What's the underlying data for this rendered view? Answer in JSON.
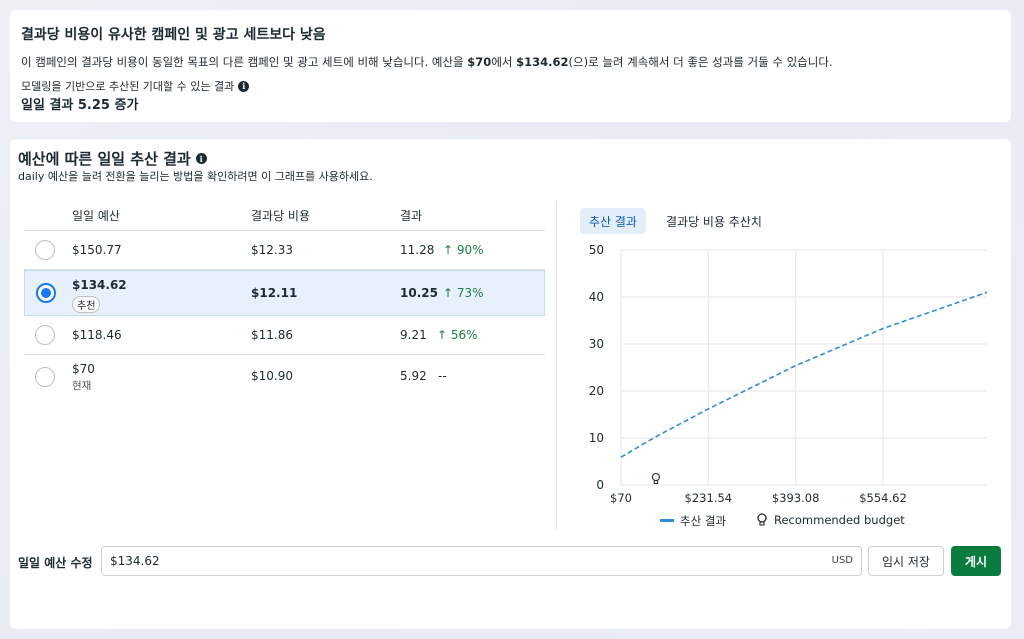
{
  "banner": {
    "title": "결과당 비용이 유사한 캠페인 및 광고 세트보다 낮음",
    "desc_pre": "이 캠페인의 결과당 비용이 동일한 목표의 다른 캠페인 및 광고 세트에 비해 낮습니다. 예산을 ",
    "desc_budget_from": "$70",
    "desc_mid": "에서 ",
    "desc_budget_to": "$134.62",
    "desc_post": "(으)로 늘려 계속해서 더 좋은 성과를 거둘 수 있습니다.",
    "model_note": "모델링을 기반으로 추산된 기대할 수 있는 결과",
    "daily_increase": "일일 결과 5.25 증가"
  },
  "section": {
    "title": "예산에 따른 일일 추산 결과",
    "subtitle": "daily 예산을 늘려 전환을 늘리는 방법을 확인하려면 이 그래프를 사용하세요."
  },
  "table": {
    "headers": [
      "일일 예산",
      "결과당 비용",
      "결과"
    ],
    "rows": [
      {
        "budget": "$150.77",
        "tag": "",
        "cost": "$12.33",
        "results": "11.28",
        "change": "↑ 90%",
        "selected": false
      },
      {
        "budget": "$134.62",
        "tag": "추천",
        "cost": "$12.11",
        "results": "10.25",
        "change": "↑ 73%",
        "selected": true
      },
      {
        "budget": "$118.46",
        "tag": "",
        "cost": "$11.86",
        "results": "9.21",
        "change": "↑ 56%",
        "selected": false
      },
      {
        "budget": "$70",
        "tag": "현재",
        "cost": "$10.90",
        "results": "5.92",
        "change": "--",
        "selected": false
      }
    ]
  },
  "tabs": [
    "추산 결과",
    "결과당 비용 추산치"
  ],
  "chart_data": {
    "type": "line",
    "x_ticks": [
      "$70",
      "$231.54",
      "$393.08",
      "$554.62"
    ],
    "x_range": [
      70,
      747
    ],
    "y_ticks": [
      0,
      10,
      20,
      30,
      40,
      50
    ],
    "ylim": [
      0,
      50
    ],
    "series": [
      {
        "name": "추산 결과",
        "style": "dashed",
        "color": "#2d8fd5",
        "points": [
          [
            70,
            5.92
          ],
          [
            118.46,
            9.21
          ],
          [
            134.62,
            10.25
          ],
          [
            150.77,
            11.28
          ],
          [
            231.54,
            16.2
          ],
          [
            393.08,
            25.4
          ],
          [
            554.62,
            33.3
          ],
          [
            747,
            41.0
          ]
        ]
      }
    ],
    "marker": {
      "name": "Recommended budget",
      "x": 134.62
    },
    "grid": true,
    "legend": "bottom"
  },
  "legend": {
    "series_label": "추산 결과",
    "marker_label": "Recommended budget"
  },
  "edit": {
    "label": "일일 예산 수정",
    "value": "$134.62",
    "currency": "USD",
    "draft_button": "임시 저장",
    "publish_button": "게시"
  },
  "colors": {
    "accent": "#1877f2",
    "publish": "#0a7b3e",
    "positive": "#1e7e45",
    "line": "#2d8fd5"
  }
}
